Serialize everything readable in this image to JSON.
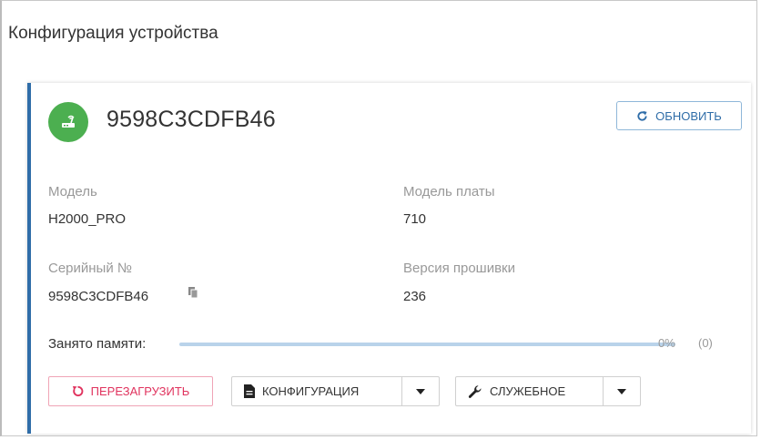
{
  "page": {
    "title": "Конфигурация устройства"
  },
  "device": {
    "name": "9598C3CDFB46",
    "status_color": "#4caf50",
    "avatar_icon": "router-icon"
  },
  "actions": {
    "refresh_label": "ОБНОВИТЬ"
  },
  "info": {
    "model_label": "Модель",
    "model_value": "H2000_PRO",
    "board_label": "Модель платы",
    "board_value": "710",
    "serial_label": "Серийный №",
    "serial_value": "9598C3CDFB46",
    "firmware_label": "Версия прошивки",
    "firmware_value": "236"
  },
  "memory": {
    "label": "Занято памяти:",
    "percent_text": "0%",
    "count_text": "(0)",
    "fraction_used": 0
  },
  "buttons": {
    "reboot_label": "ПЕРЕЗАГРУЗИТЬ",
    "config_label": "КОНФИГУРАЦИЯ",
    "service_label": "СЛУЖЕБНОЕ"
  },
  "colors": {
    "accent": "#2f6da8",
    "danger": "#e0335e",
    "muted": "#999999"
  }
}
